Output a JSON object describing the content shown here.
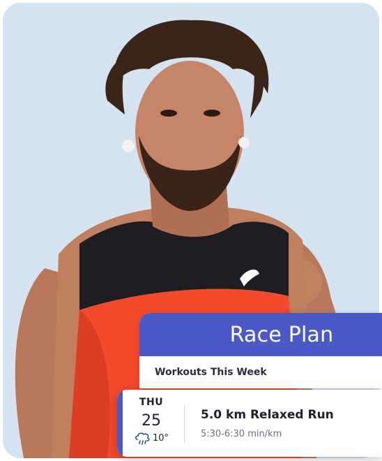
{
  "race_plan": {
    "title": "Race Plan",
    "subtitle": "Workouts This Week"
  },
  "workout": {
    "day_of_week": "THU",
    "day_number": "25",
    "temperature": "10°",
    "weather_icon": "cloud-rain-icon",
    "name": "5.0 km Relaxed Run",
    "pace": "5:30-6:30 min/km"
  },
  "colors": {
    "accent": "#4a58c8",
    "text_dark": "#1e2030",
    "text_muted": "#6d7080"
  }
}
